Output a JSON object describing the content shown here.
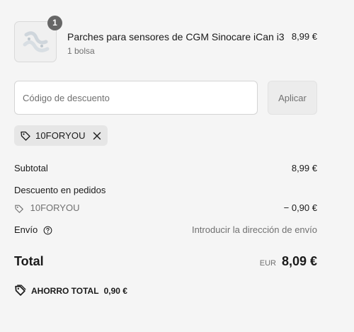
{
  "product": {
    "quantity": "1",
    "name": "Parches para sensores de CGM Sinocare iCan i3",
    "variant": "1 bolsa",
    "price": "8,99 €"
  },
  "discount": {
    "placeholder": "Código de descuento",
    "apply_label": "Aplicar",
    "applied_code": "10FORYOU"
  },
  "summary": {
    "subtotal_label": "Subtotal",
    "subtotal_value": "8,99 €",
    "order_discount_label": "Descuento en pedidos",
    "discount_code": "10FORYOU",
    "discount_value": "− 0,90 €",
    "shipping_label": "Envío",
    "shipping_value": "Introducir la dirección de envío",
    "total_label": "Total",
    "currency": "EUR",
    "total_value": "8,09 €",
    "savings_label": "AHORRO TOTAL",
    "savings_value": "0,90 €"
  },
  "icons": {
    "tag": "tag-icon",
    "close": "close-icon",
    "help": "help-circle-icon"
  },
  "colors": {
    "background": "#f5f5f5",
    "muted_text": "#707070",
    "badge": "#666666",
    "chip": "#e6e6e6"
  }
}
